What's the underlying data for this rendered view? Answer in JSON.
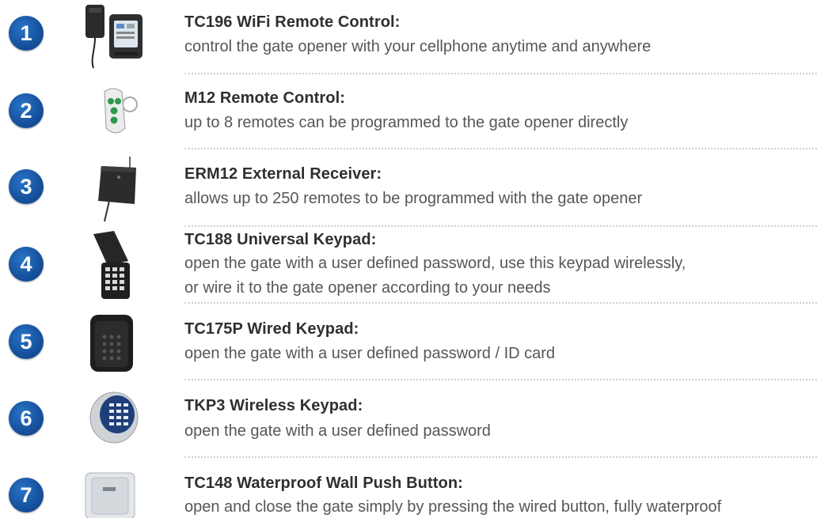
{
  "items": [
    {
      "number": "1",
      "icon": "wifi-remote-control-device",
      "title": "TC196 WiFi Remote Control:",
      "lines": [
        "control the gate opener with your cellphone anytime and anywhere"
      ]
    },
    {
      "number": "2",
      "icon": "key-fob-remote",
      "title": "M12 Remote Control:",
      "lines": [
        "up to 8 remotes can be programmed to the gate opener directly"
      ]
    },
    {
      "number": "3",
      "icon": "external-receiver-box",
      "title": "ERM12 External Receiver:",
      "lines": [
        "allows up to 250 remotes to be programmed with the gate opener"
      ]
    },
    {
      "number": "4",
      "icon": "universal-keypad",
      "title": "TC188 Universal Keypad:",
      "lines": [
        "open the gate with a user defined password, use this keypad wirelessly,",
        "or wire it to the gate opener according to your needs"
      ]
    },
    {
      "number": "5",
      "icon": "wired-keypad",
      "title": "TC175P Wired Keypad:",
      "lines": [
        "open the gate with a user defined password / ID card"
      ]
    },
    {
      "number": "6",
      "icon": "round-wireless-keypad",
      "title": "TKP3 Wireless Keypad:",
      "lines": [
        "open the gate with a user defined password"
      ]
    },
    {
      "number": "7",
      "icon": "waterproof-push-button",
      "title": "TC148 Waterproof Wall Push Button:",
      "lines": [
        "open and close the gate simply by pressing the wired button, fully waterproof"
      ]
    }
  ],
  "colors": {
    "badge": "#17539f",
    "title": "#2f2f2f",
    "description": "#565656",
    "divider": "#cfcfcf"
  }
}
